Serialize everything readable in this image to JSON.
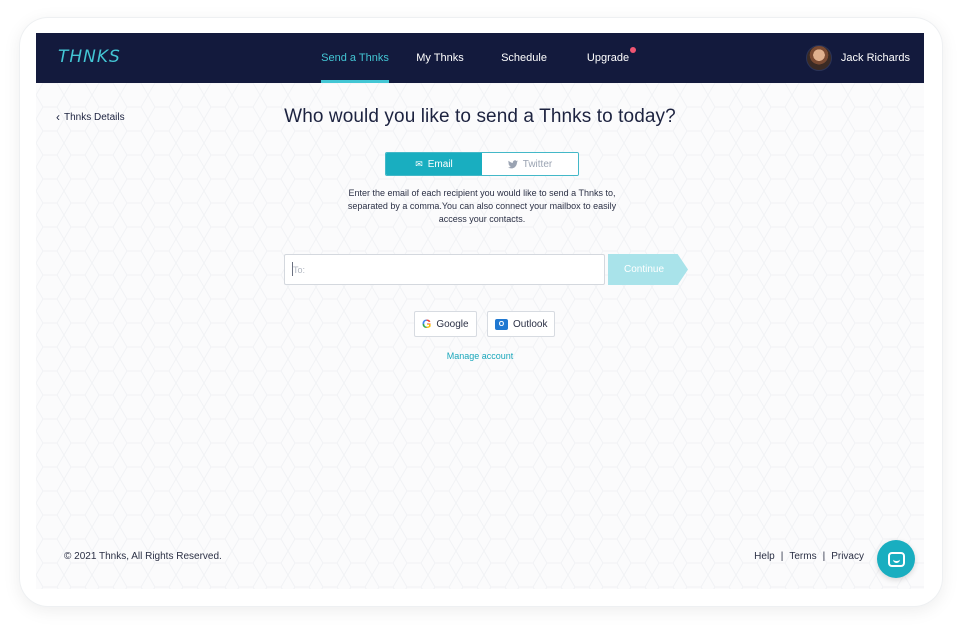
{
  "brand": {
    "logo_text": "THNKS",
    "accent": "#43c6d4",
    "nav_bg": "#131a3d"
  },
  "nav": {
    "items": [
      {
        "label": "Send a Thnks",
        "active": true
      },
      {
        "label": "My Thnks",
        "active": false
      },
      {
        "label": "Schedule",
        "active": false
      },
      {
        "label": "Upgrade",
        "active": false,
        "notification_dot_color": "#ef5572"
      }
    ],
    "user": {
      "name": "Jack Richards",
      "avatar_icon": "user-avatar"
    }
  },
  "main": {
    "back_label": "Thnks Details",
    "heading": "Who would you like to send a Thnks to today?",
    "tabs": [
      {
        "label": "Email",
        "icon": "envelope-icon",
        "active": true
      },
      {
        "label": "Twitter",
        "icon": "twitter-icon",
        "active": false
      }
    ],
    "description": "Enter the email of each recipient you would like to send a Thnks to, separated by a comma.You can also connect your mailbox to easily access your contacts.",
    "to_input": {
      "placeholder": "To:",
      "value": ""
    },
    "continue_label": "Continue",
    "providers": [
      {
        "label": "Google",
        "icon": "google-icon"
      },
      {
        "label": "Outlook",
        "icon": "outlook-icon"
      }
    ],
    "manage_account_label": "Manage account"
  },
  "footer": {
    "copyright": "© 2021 Thnks, All Rights Reserved.",
    "links": [
      "Help",
      "Terms",
      "Privacy"
    ],
    "separator": "|",
    "chat_icon": "chat-icon"
  }
}
